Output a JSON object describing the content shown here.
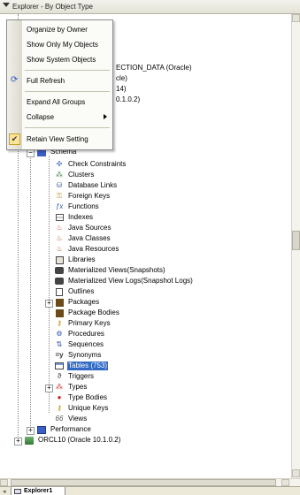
{
  "title_bar": {
    "title": "Explorer - By Object Type"
  },
  "context_menu": {
    "items": [
      {
        "label": "Organize by Owner"
      },
      {
        "label": "Show Only My Objects"
      },
      {
        "label": "Show System Objects"
      },
      {
        "label": "Full Refresh"
      },
      {
        "label": "Expand All Groups"
      },
      {
        "label": "Collapse"
      },
      {
        "label": "Retain View Setting",
        "checked": true
      }
    ]
  },
  "tree": {
    "behind_menu": [
      "ECTION_DATA (Oracle)",
      "cle)",
      "14)",
      "0.1.0.2)"
    ],
    "schema_label": "Schema",
    "items": [
      {
        "label": "Check Constraints",
        "icon": "check-constraint-icon"
      },
      {
        "label": "Clusters",
        "icon": "cluster-icon"
      },
      {
        "label": "Database Links",
        "icon": "database-link-icon"
      },
      {
        "label": "Foreign Keys",
        "icon": "foreign-key-icon"
      },
      {
        "label": "Functions",
        "icon": "function-icon"
      },
      {
        "label": "Indexes",
        "icon": "index-icon"
      },
      {
        "label": "Java Sources",
        "icon": "java-source-icon"
      },
      {
        "label": "Java Classes",
        "icon": "java-class-icon"
      },
      {
        "label": "Java Resources",
        "icon": "java-resource-icon"
      },
      {
        "label": "Libraries",
        "icon": "library-icon"
      },
      {
        "label": "Materialized Views(Snapshots)",
        "icon": "materialized-view-icon"
      },
      {
        "label": "Materialized View Logs(Snapshot Logs)",
        "icon": "materialized-view-log-icon"
      },
      {
        "label": "Outlines",
        "icon": "outline-icon"
      },
      {
        "label": "Packages",
        "icon": "package-icon",
        "expandable": true
      },
      {
        "label": "Package Bodies",
        "icon": "package-body-icon"
      },
      {
        "label": "Primary Keys",
        "icon": "primary-key-icon"
      },
      {
        "label": "Procedures",
        "icon": "procedure-icon"
      },
      {
        "label": "Sequences",
        "icon": "sequence-icon"
      },
      {
        "label": "Synonyms",
        "icon": "synonym-icon"
      },
      {
        "label": "Tables (753)",
        "icon": "table-icon",
        "selected": true
      },
      {
        "label": "Triggers",
        "icon": "trigger-icon"
      },
      {
        "label": "Types",
        "icon": "type-icon",
        "expandable": true
      },
      {
        "label": "Type Bodies",
        "icon": "type-body-icon"
      },
      {
        "label": "Unique Keys",
        "icon": "unique-key-icon"
      },
      {
        "label": "Views",
        "icon": "view-icon"
      }
    ],
    "performance_label": "Performance",
    "db_label": "ORCL10 (Oracle 10.1.0.2)"
  },
  "tabs": [
    {
      "label": "Explorer1"
    }
  ],
  "colors": {
    "selection": "#316ac5",
    "menu_background": "#fbfbf8",
    "chrome": "#ece9d8"
  }
}
